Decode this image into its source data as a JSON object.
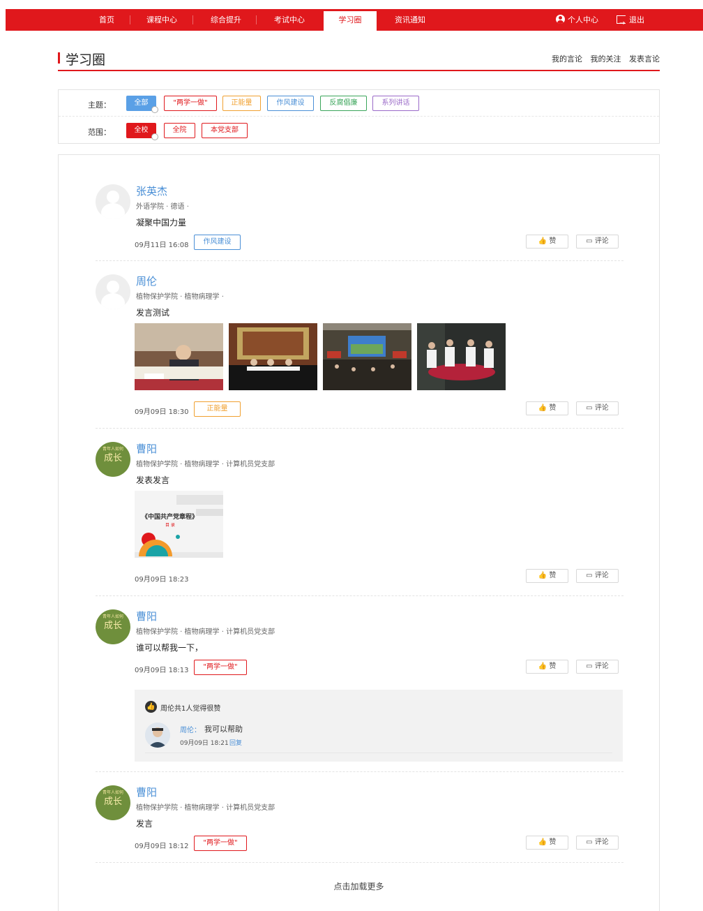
{
  "nav": {
    "items": [
      "首页",
      "课程中心",
      "综合提升",
      "考试中心",
      "学习圈",
      "资讯通知"
    ],
    "active": "学习圈",
    "user_center": "个人中心",
    "logout": "退出"
  },
  "header": {
    "title": "学习圈",
    "links": [
      "我的言论",
      "我的关注",
      "发表言论"
    ]
  },
  "filters": {
    "topic_label": "主题：",
    "topics": [
      "全部",
      "\"两学一做\"",
      "正能量",
      "作风建设",
      "反腐倡廉",
      "系列讲话"
    ],
    "topic_selected": "全部",
    "scope_label": "范围：",
    "scopes": [
      "全校",
      "全院",
      "本党支部"
    ],
    "scope_selected": "全校"
  },
  "colors": {
    "brand": "#e0181c",
    "link_blue": "#4a8fd6",
    "tag_liangxue": "#e0181c",
    "tag_zhengnengliang": "#f0a030",
    "tag_zuofeng": "#4a8fd6",
    "tag_fanfu": "#3aa55a",
    "tag_jianghua": "#9a6ac8",
    "topic_all_selected": "#5aa0e6"
  },
  "posts": [
    {
      "name": "张英杰",
      "meta": "外语学院 · 德语 ·",
      "text": "凝聚中国力量",
      "date": "09月11日 16:08",
      "tag": "作风建设",
      "avatar": "default-avatar"
    },
    {
      "name": "周伦",
      "meta": "植物保护学院 · 植物病理学 ·",
      "text": "发言测试",
      "date": "09月09日 18:30",
      "tag": "正能量",
      "avatar": "default-avatar"
    },
    {
      "name": "曹阳",
      "meta": "植物保护学院 · 植物病理学 · 计算机员党支部",
      "text": "发表发言",
      "date": "09月09日 18:23",
      "image_title": "《中国共产党章程》",
      "image_sub": "目 录",
      "avatar": "growth-avatar"
    },
    {
      "name": "曹阳",
      "meta": "植物保护学院 · 植物病理学 · 计算机员党支部",
      "text": "谁可以帮我一下，",
      "date": "09月09日 18:13",
      "tag": "\"两学一做\"",
      "avatar": "growth-avatar",
      "likes_line": "周伦共1人觉得很赞",
      "reply": {
        "name": "周伦：",
        "text": "我可以帮助",
        "date": "09月09日 18:21",
        "action": "回复"
      }
    },
    {
      "name": "曹阳",
      "meta": "植物保护学院 · 植物病理学 · 计算机员党支部",
      "text": "发言",
      "date": "09月09日 18:12",
      "tag": "\"两学一做\"",
      "avatar": "growth-avatar"
    }
  ],
  "growth_avatar": {
    "top": "青年人如何",
    "main": "成长"
  },
  "actions": {
    "like": "赞",
    "comment": "评论"
  },
  "load_more": "点击加载更多"
}
